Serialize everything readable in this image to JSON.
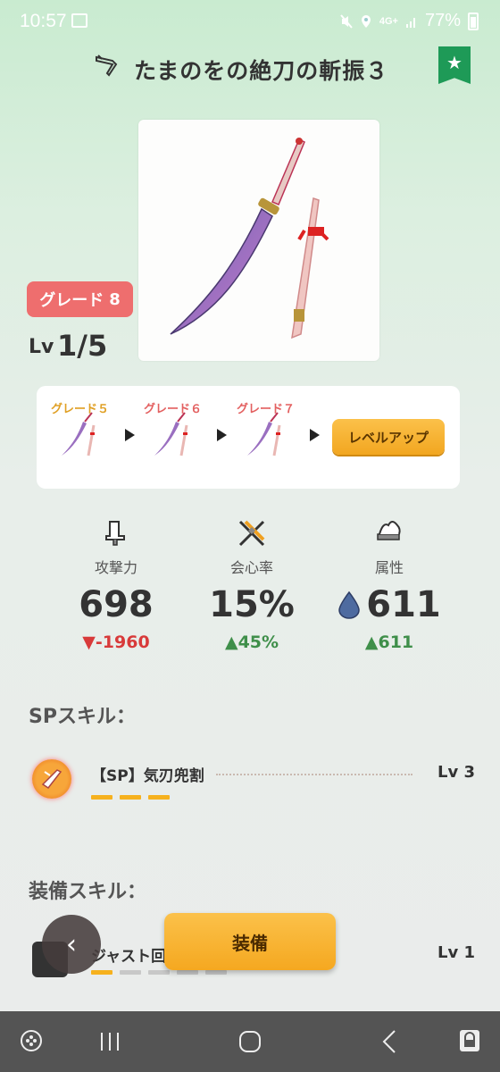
{
  "status": {
    "time": "10:57",
    "network": "4G+",
    "battery": "77%"
  },
  "header": {
    "title": "たまのをの絶刀の斬振３",
    "bookmark_icon": "star-icon"
  },
  "weapon": {
    "grade_label": "グレード",
    "grade_value": "8",
    "lv_prefix": "Lv",
    "lv_value": "1/5"
  },
  "grade_path": {
    "steps": [
      {
        "label": "グレード５"
      },
      {
        "label": "グレード６"
      },
      {
        "label": "グレード７"
      }
    ],
    "level_up_label": "レベルアップ"
  },
  "stats": [
    {
      "label": "攻撃力",
      "value": "698",
      "diff": "▼-1960",
      "icon": "attack-icon"
    },
    {
      "label": "会心率",
      "value": "15%",
      "diff": "▲45%",
      "icon": "critical-icon"
    },
    {
      "label": "属性",
      "value": "611",
      "diff": "▲611",
      "icon": "element-icon"
    }
  ],
  "sp_skills": {
    "title": "SPスキル：",
    "items": [
      {
        "name": "【SP】気刃兜割",
        "lv": "Lv 3",
        "level": 3,
        "max": 3
      }
    ]
  },
  "equip_skills": {
    "title": "装備スキル：",
    "items": [
      {
        "name": "ジャスト回",
        "lv": "Lv 1",
        "level": 1,
        "max": 5
      }
    ]
  },
  "buttons": {
    "equip": "装備",
    "back": "‹"
  },
  "colors": {
    "accent": "#f5a820",
    "grade_badge": "#ee6e6e",
    "bookmark": "#1e9a57",
    "down": "#d83a3a",
    "up": "#3f8f4a"
  }
}
